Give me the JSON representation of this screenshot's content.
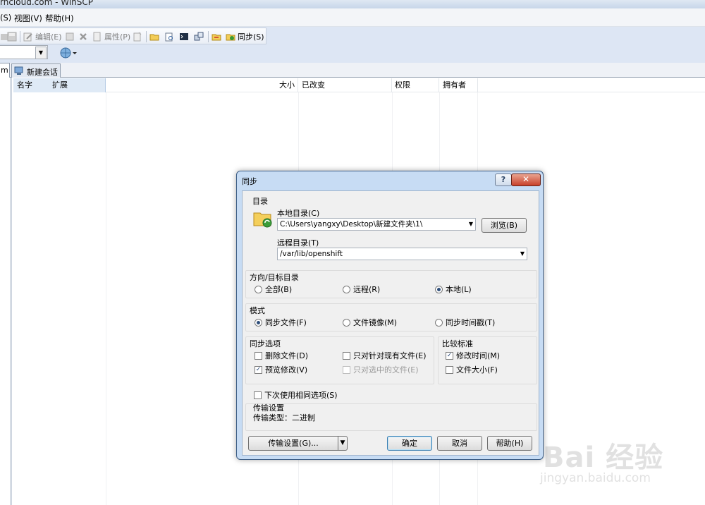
{
  "window": {
    "title": "rhcloud.com - WinSCP"
  },
  "menu": {
    "items": [
      "(S)",
      "视图(V)",
      "帮助(H)"
    ]
  },
  "toolbar": {
    "edit_label": "编辑(E)",
    "properties_label": "属性(P)",
    "sync_label": "同步(S)"
  },
  "tabs": {
    "left_label": "m",
    "new_session_label": "新建会话"
  },
  "file_list": {
    "columns": [
      "名字",
      "扩展",
      "大小",
      "已改变",
      "权限",
      "拥有者"
    ]
  },
  "dialog": {
    "title": "同步",
    "help_glyph": "?",
    "close_glyph": "✕",
    "directory": {
      "group_title": "目录",
      "local_label": "本地目录(C)",
      "local_value": "C:\\Users\\yangxy\\Desktop\\新建文件夹\\1\\",
      "browse_label": "浏览(B)",
      "remote_label": "远程目录(T)",
      "remote_value": "/var/lib/openshift"
    },
    "direction": {
      "group_title": "方向/目标目录",
      "options": [
        "全部(B)",
        "远程(R)",
        "本地(L)"
      ],
      "selected": "本地(L)"
    },
    "mode": {
      "group_title": "模式",
      "options": [
        "同步文件(F)",
        "文件镜像(M)",
        "同步时间戳(T)"
      ],
      "selected": "同步文件(F)"
    },
    "sync_options": {
      "group_title": "同步选项",
      "delete_files": {
        "label": "删除文件(D)",
        "checked": false
      },
      "existing_only": {
        "label": "只对针对现有文件(E)",
        "checked": false
      },
      "preview_changes": {
        "label": "预览修改(V)",
        "checked": true
      },
      "selected_only": {
        "label": "只对选中的文件(E)",
        "checked": false,
        "disabled": true
      }
    },
    "compare": {
      "group_title": "比较标准",
      "modification_time": {
        "label": "修改时间(M)",
        "checked": true
      },
      "file_size": {
        "label": "文件大小(F)",
        "checked": false
      }
    },
    "reuse_options": {
      "label": "下次使用相同选项(S)",
      "checked": false
    },
    "transfer": {
      "group_title": "传输设置",
      "type_text": "传输类型：二进制"
    },
    "buttons": {
      "transfer_settings": "传输设置(G)...",
      "ok": "确定",
      "cancel": "取消",
      "help": "帮助(H)"
    }
  },
  "watermark": {
    "main": "Bai 经验",
    "sub": "jingyan.baidu.com"
  },
  "colors": {
    "accent": "#3c7fb1",
    "dialog_frame": "#c7dcf4",
    "toolbar_bg": "#dde6f4",
    "close_button": "#c8412b"
  }
}
